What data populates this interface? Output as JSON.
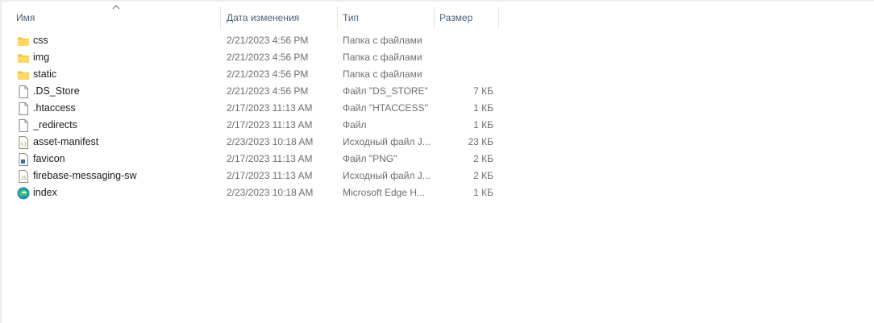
{
  "columns": {
    "name": "Имя",
    "date": "Дата изменения",
    "type": "Тип",
    "size": "Размер"
  },
  "files": [
    {
      "name": "css",
      "date": "2/21/2023 4:56 PM",
      "type": "Папка с файлами",
      "size": "",
      "icon": "folder-icon"
    },
    {
      "name": "img",
      "date": "2/21/2023 4:56 PM",
      "type": "Папка с файлами",
      "size": "",
      "icon": "folder-icon"
    },
    {
      "name": "static",
      "date": "2/21/2023 4:56 PM",
      "type": "Папка с файлами",
      "size": "",
      "icon": "folder-icon"
    },
    {
      "name": ".DS_Store",
      "date": "2/21/2023 4:56 PM",
      "type": "Файл \"DS_STORE\"",
      "size": "7 КБ",
      "icon": "file-icon"
    },
    {
      "name": ".htaccess",
      "date": "2/17/2023 11:13 AM",
      "type": "Файл \"HTACCESS\"",
      "size": "1 КБ",
      "icon": "file-icon"
    },
    {
      "name": "_redirects",
      "date": "2/17/2023 11:13 AM",
      "type": "Файл",
      "size": "1 КБ",
      "icon": "file-icon"
    },
    {
      "name": "asset-manifest",
      "date": "2/23/2023 10:18 AM",
      "type": "Исходный файл J...",
      "size": "23 КБ",
      "icon": "json-file-icon"
    },
    {
      "name": "favicon",
      "date": "2/17/2023 11:13 AM",
      "type": "Файл \"PNG\"",
      "size": "2 КБ",
      "icon": "png-file-icon"
    },
    {
      "name": "firebase-messaging-sw",
      "date": "2/17/2023 11:13 AM",
      "type": "Исходный файл J...",
      "size": "2 КБ",
      "icon": "js-file-icon"
    },
    {
      "name": "index",
      "date": "2/23/2023 10:18 AM",
      "type": "Microsoft Edge H...",
      "size": "1 КБ",
      "icon": "edge-icon"
    }
  ]
}
